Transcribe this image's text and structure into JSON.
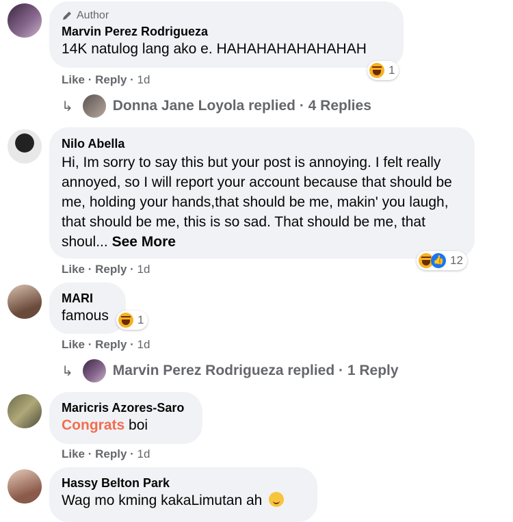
{
  "comments": [
    {
      "author_badge": "Author",
      "name": "Marvin Perez Rodrigueza",
      "text": "14K natulog lang ako e. HAHAHAHAHAHAHAH",
      "reaction_count": "1",
      "actions": {
        "like": "Like",
        "sep1": " · ",
        "reply": "Reply",
        "sep2": " · ",
        "time": "1d"
      },
      "replies": "Donna Jane Loyola replied · 4 Replies"
    },
    {
      "name": "Nilo Abella",
      "text": "Hi, Im sorry to say this but your post is annoying. I felt really annoyed, so I will report your account because that should be me, holding your hands,that should be me, makin' you laugh, that should be me, this is so sad. That should be me, that shoul...",
      "see_more": "See More",
      "reaction_count": "12",
      "actions": {
        "like": "Like",
        "sep1": " · ",
        "reply": "Reply",
        "sep2": " · ",
        "time": "1d"
      }
    },
    {
      "name": "MARI",
      "text": "famous",
      "reaction_count": "1",
      "actions": {
        "like": "Like",
        "sep1": " · ",
        "reply": "Reply",
        "sep2": " · ",
        "time": "1d"
      },
      "replies": "Marvin Perez Rodrigueza replied · 1 Reply"
    },
    {
      "name": "Maricris Azores-Saro",
      "text_highlight": "Congrats",
      "text": " boi",
      "actions": {
        "like": "Like",
        "sep1": " · ",
        "reply": "Reply",
        "sep2": " · ",
        "time": "1d"
      }
    },
    {
      "name": "Hassy Belton Park",
      "text": "Wag mo kming kakaLimutan ah"
    }
  ],
  "icons": {
    "pencil": "pencil-icon",
    "reply_arrow": "reply-arrow-icon",
    "haha": "haha-reaction-icon",
    "like": "like-reaction-icon",
    "smile": "smile-emoji-icon"
  },
  "colors": {
    "bubble": "#f0f2f5",
    "secondary_text": "#65676b",
    "congrats": "#f26d4f",
    "like_blue": "#1877f2"
  }
}
